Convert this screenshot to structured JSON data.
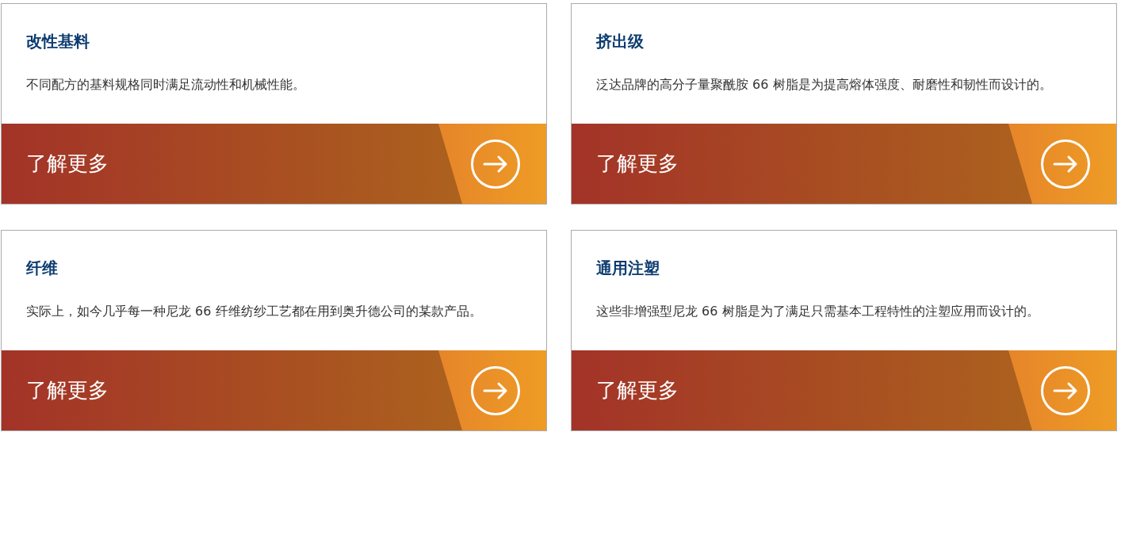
{
  "cards": [
    {
      "title": "改性基料",
      "description": "不同配方的基料规格同时满足流动性和机械性能。",
      "link": "了解更多"
    },
    {
      "title": "挤出级",
      "description": "泛达品牌的高分子量聚酰胺 66 树脂是为提高熔体强度、耐磨性和韧性而设计的。",
      "link": "了解更多"
    },
    {
      "title": "纤维",
      "description": "实际上，如今几乎每一种尼龙 66 纤维纺纱工艺都在用到奥升德公司的某款产品。",
      "link": "了解更多"
    },
    {
      "title": "通用注塑",
      "description": "这些非增强型尼龙 66 树脂是为了满足只需基本工程特性的注塑应用而设计的。",
      "link": "了解更多"
    }
  ]
}
